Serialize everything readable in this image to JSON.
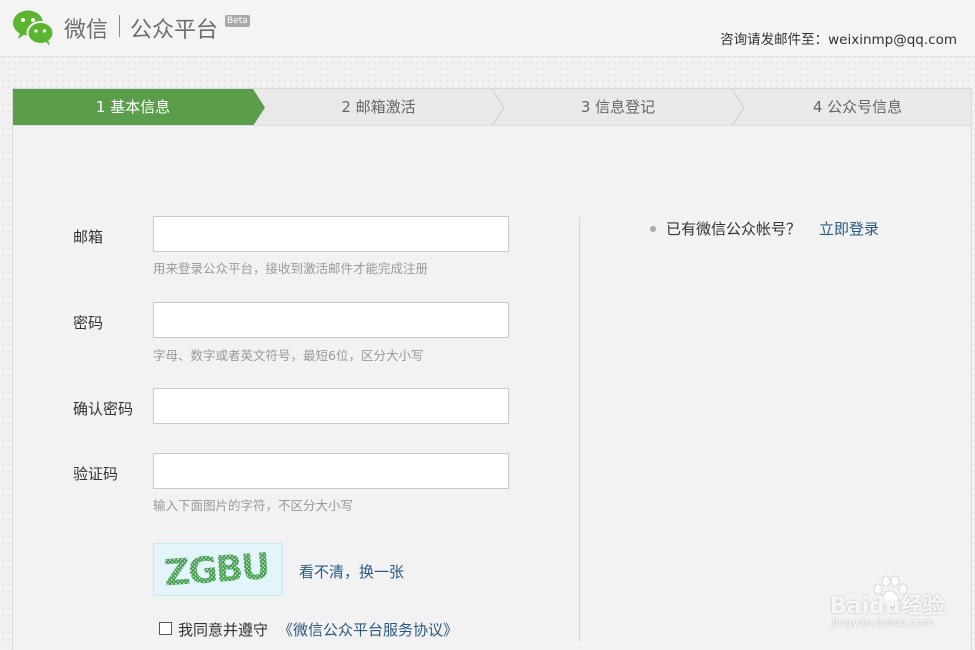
{
  "header": {
    "brand_name": "微信",
    "platform_name": "公众平台",
    "beta_label": "Beta",
    "contact_text": "咨询请发邮件至：weixinmp@qq.com",
    "logo_icon": "wechat-logo-icon"
  },
  "steps": [
    {
      "label": "1 基本信息",
      "active": true
    },
    {
      "label": "2 邮箱激活",
      "active": false
    },
    {
      "label": "3 信息登记",
      "active": false
    },
    {
      "label": "4 公众号信息",
      "active": false
    }
  ],
  "colors": {
    "accent_green": "#5a9e4b",
    "link_blue": "#2b5a80",
    "step_inactive": "#e9e9e9"
  },
  "form": {
    "email": {
      "label": "邮箱",
      "value": "",
      "hint": "用来登录公众平台，接收到激活邮件才能完成注册"
    },
    "password": {
      "label": "密码",
      "value": "",
      "hint": "字母、数字或者英文符号，最短6位，区分大小写"
    },
    "confirm_password": {
      "label": "确认密码",
      "value": ""
    },
    "captcha": {
      "label": "验证码",
      "value": "",
      "hint": "输入下面图片的字符，不区分大小写",
      "image_text": "ZGBU",
      "refresh_text": "看不清，换一张"
    },
    "agreement": {
      "text": "我同意并遵守",
      "link_text": "《微信公众平台服务协议》",
      "checked": false
    }
  },
  "sidebar": {
    "login_question": "已有微信公众帐号？",
    "login_link": "立即登录"
  },
  "watermark": {
    "brand": "Baidu经验",
    "url": "jingyan.baidu.com"
  }
}
